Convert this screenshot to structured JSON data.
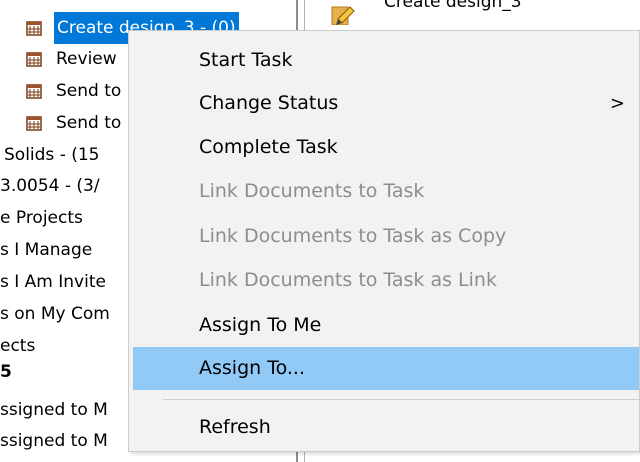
{
  "tree": {
    "items": [
      {
        "label": "Create design_3 - (0)",
        "icon": "calendar-icon"
      },
      {
        "label": "Review",
        "icon": "calendar-icon"
      },
      {
        "label": "Send to",
        "icon": "calendar-icon"
      },
      {
        "label": "Send to",
        "icon": "calendar-icon"
      },
      {
        "label": "Solids - (15"
      },
      {
        "label": "3.0054 - (3/"
      },
      {
        "label": "e Projects"
      },
      {
        "label": "s I Manage"
      },
      {
        "label": "s I Am Invite"
      },
      {
        "label": "s on My Com"
      },
      {
        "label": "ects"
      },
      {
        "label": "5"
      },
      {
        "label": "ssigned to M"
      },
      {
        "label": "ssigned to M"
      }
    ]
  },
  "right_panel": {
    "label": "Create design_3",
    "icon": "document-edit-icon"
  },
  "context_menu": {
    "items": [
      {
        "label": "Start Task",
        "enabled": true
      },
      {
        "label": "Change Status",
        "enabled": true,
        "submenu": true
      },
      {
        "label": "Complete Task",
        "enabled": true
      },
      {
        "label": "Link Documents to Task",
        "enabled": false
      },
      {
        "label": "Link Documents to Task as Copy",
        "enabled": false
      },
      {
        "label": "Link Documents to Task as Link",
        "enabled": false
      },
      {
        "label": "Assign To Me",
        "enabled": true
      },
      {
        "label": "Assign To...",
        "enabled": true,
        "highlighted": true
      },
      {
        "label": "Refresh",
        "enabled": true
      }
    ],
    "submenu_arrow": ">"
  },
  "colors": {
    "selection": "#0078d7",
    "menu_hover": "#91c9f7",
    "menu_bg": "#f2f2f2",
    "disabled_text": "#8d8d8d"
  }
}
